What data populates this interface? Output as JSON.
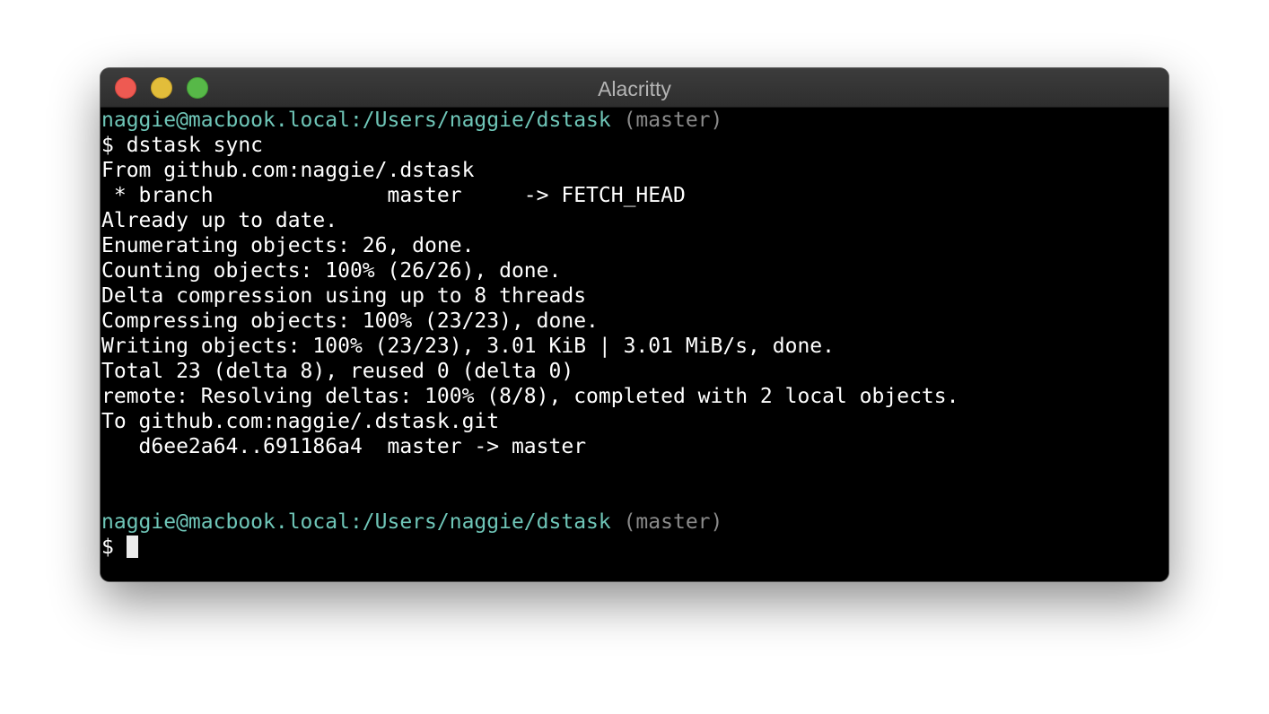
{
  "window": {
    "title": "Alacritty",
    "controls": {
      "close": "close",
      "minimize": "minimize",
      "zoom": "zoom"
    },
    "colors": {
      "close": "#ee5a52",
      "minimize": "#e2bd3a",
      "zoom": "#57b848"
    }
  },
  "terminal": {
    "prompt_path": "naggie@macbook.local:/Users/naggie/dstask",
    "prompt_branch": " (master)",
    "prompt_symbol": "$ ",
    "command": "dstask sync",
    "output": [
      "From github.com:naggie/.dstask",
      " * branch              master     -> FETCH_HEAD",
      "Already up to date.",
      "Enumerating objects: 26, done.",
      "Counting objects: 100% (26/26), done.",
      "Delta compression using up to 8 threads",
      "Compressing objects: 100% (23/23), done.",
      "Writing objects: 100% (23/23), 3.01 KiB | 3.01 MiB/s, done.",
      "Total 23 (delta 8), reused 0 (delta 0)",
      "remote: Resolving deltas: 100% (8/8), completed with 2 local objects.",
      "To github.com:naggie/.dstask.git",
      "   d6ee2a64..691186a4  master -> master"
    ],
    "colors": {
      "background": "#000000",
      "text": "#ffffff",
      "path": "#6fc6b8",
      "branch": "#8a8a8a"
    }
  }
}
